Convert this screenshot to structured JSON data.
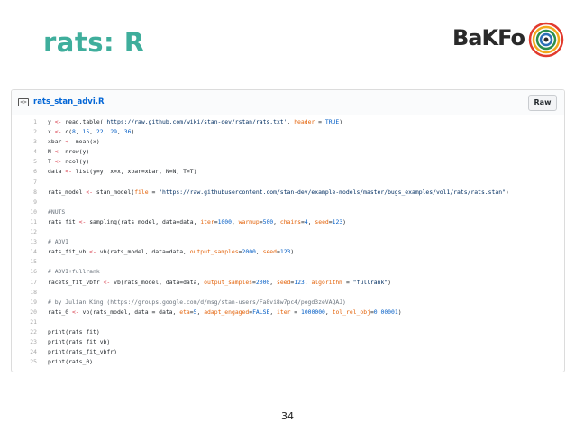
{
  "slide": {
    "title": "rats: R",
    "page_number": "34"
  },
  "logo": {
    "text": "BaKFo",
    "colors": [
      "#e23b2e",
      "#f2a81d",
      "#2d8e4b",
      "#2c6fb6",
      "#7b3f99"
    ]
  },
  "gist": {
    "file_icon": "file-code-icon",
    "file_name": "rats_stan_advi.R",
    "raw_label": "Raw",
    "lines": [
      {
        "n": "1",
        "text": "y <- read.table('https://raw.github.com/wiki/stan-dev/rstan/rats.txt', header = TRUE)"
      },
      {
        "n": "2",
        "text": "x <- c(8, 15, 22, 29, 36)"
      },
      {
        "n": "3",
        "text": "xbar <- mean(x)"
      },
      {
        "n": "4",
        "text": "N <- nrow(y)"
      },
      {
        "n": "5",
        "text": "T <- ncol(y)"
      },
      {
        "n": "6",
        "text": "data <- list(y=y, x=x, xbar=xbar, N=N, T=T)"
      },
      {
        "n": "7",
        "text": ""
      },
      {
        "n": "8",
        "text": "rats_model <- stan_model(file = \"https://raw.githubusercontent.com/stan-dev/example-models/master/bugs_examples/vol1/rats/rats.stan\")"
      },
      {
        "n": "9",
        "text": ""
      },
      {
        "n": "10",
        "text": "#NUTS"
      },
      {
        "n": "11",
        "text": "rats_fit <- sampling(rats_model, data=data, iter=1000, warmup=500, chains=4, seed=123)"
      },
      {
        "n": "12",
        "text": ""
      },
      {
        "n": "13",
        "text": "# ADVI"
      },
      {
        "n": "14",
        "text": "rats_fit_vb <- vb(rats_model, data=data, output_samples=2000, seed=123)"
      },
      {
        "n": "15",
        "text": ""
      },
      {
        "n": "16",
        "text": "# ADVI+fullrank"
      },
      {
        "n": "17",
        "text": "racets_fit_vbfr <- vb(rats_model, data=data, output_samples=2000, seed=123, algorithm = \"fullrank\")"
      },
      {
        "n": "18",
        "text": ""
      },
      {
        "n": "19",
        "text": "# by Julian King (https://groups.google.com/d/msg/stan-users/Fa8vi8w7pc4/pogd3zeVAQAJ)"
      },
      {
        "n": "20",
        "text": "rats_0 <- vb(rats_model, data = data, eta=5, adapt_engaged=FALSE, iter = 1000000, tol_rel_obj=0.00001)"
      },
      {
        "n": "21",
        "text": ""
      },
      {
        "n": "22",
        "text": "print(rats_fit)"
      },
      {
        "n": "23",
        "text": "print(rats_fit_vb)"
      },
      {
        "n": "24",
        "text": "print(rats_fit_vbfr)"
      },
      {
        "n": "25",
        "text": "print(rats_0)"
      }
    ]
  },
  "colors": {
    "title": "#3fae9c",
    "link": "#0366d6",
    "string": "#032f62",
    "number": "#005cc5",
    "comment": "#6a737d",
    "keyword": "#d73a49",
    "param": "#e36209"
  }
}
